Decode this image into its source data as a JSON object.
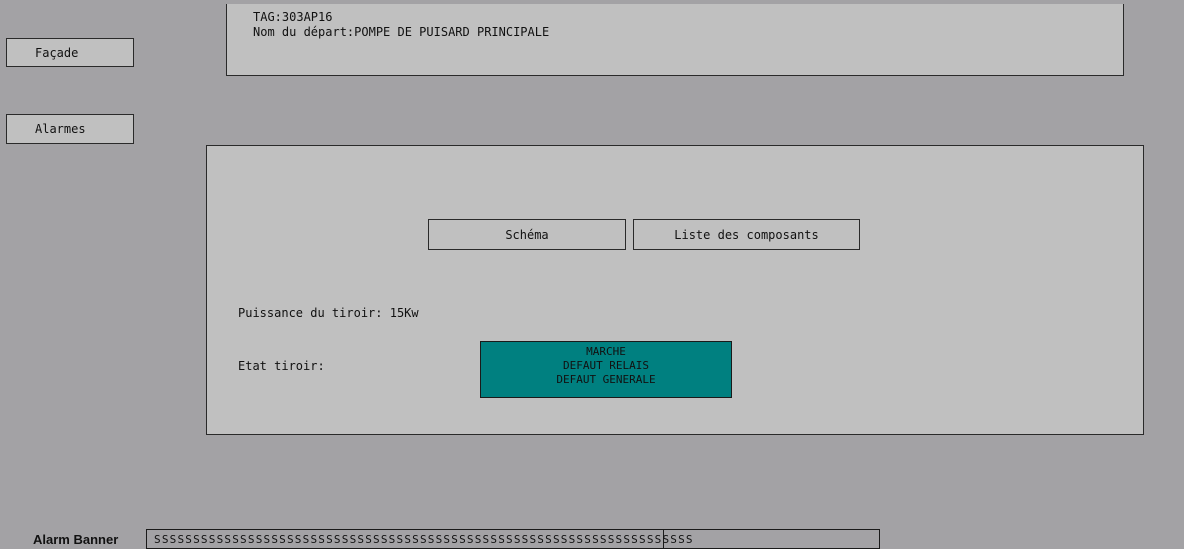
{
  "nav": {
    "facade_label": "Façade",
    "alarmes_label": "Alarmes"
  },
  "info": {
    "tag_line": "TAG:303AP16",
    "depart_line": "Nom du départ:POMPE DE PUISARD PRINCIPALE"
  },
  "main": {
    "schema_label": "Schéma",
    "composants_label": "Liste des composants",
    "puissance_text": "Puissance du tiroir: 15Kw",
    "etat_label": "Etat tiroir:",
    "etat_lines": [
      "MARCHE",
      "DEFAUT RELAIS",
      "DEFAUT GENERALE"
    ]
  },
  "colors": {
    "background": "#a3a2a5",
    "panel": "#c0c0c0",
    "status_teal": "#008080"
  },
  "alarm_banner": {
    "label": "Alarm Banner",
    "text": "SSSSSSSSSSSSSSSSSSSSSSSSSSSSSSSSSSSSSSSSSSSSSSSSSSSSSSSSSSSSSSSSSSSSS"
  }
}
